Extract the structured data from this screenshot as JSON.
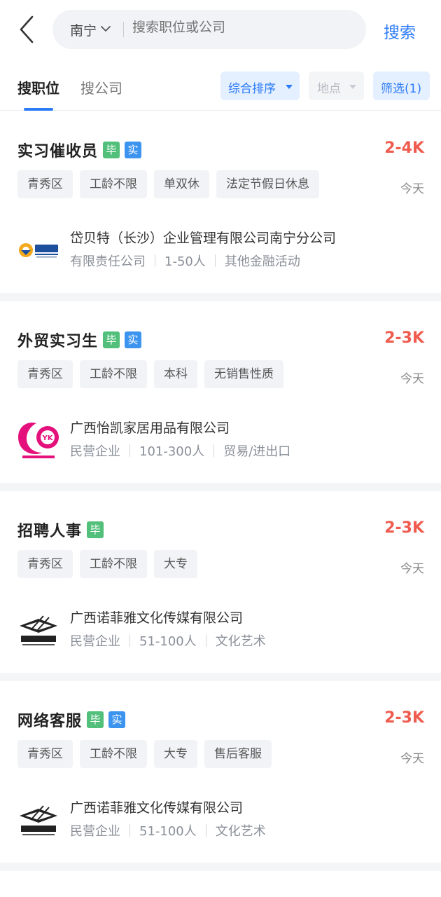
{
  "header": {
    "city": "南宁",
    "search_placeholder": "搜索职位或公司",
    "search_button": "搜索"
  },
  "tabs": {
    "jobs": "搜职位",
    "companies": "搜公司",
    "sort": "综合排序",
    "location": "地点",
    "filter": "筛选(1)"
  },
  "colors": {
    "accent": "#2d7cf6",
    "salary": "#ef5c4f",
    "grad_badge": "#52c07a",
    "intern_badge": "#3c94ef"
  },
  "jobs": [
    {
      "title": "实习催收员",
      "badges": [
        "毕",
        "实"
      ],
      "salary": "2-4K",
      "tags": [
        "青秀区",
        "工龄不限",
        "单双休",
        "法定节假日休息"
      ],
      "time": "今天",
      "company": "岱贝特（长沙）企业管理有限公司南宁分公司",
      "meta": [
        "有限责任公司",
        "1-50人",
        "其他金融活动"
      ],
      "logo": "daibeite-logo"
    },
    {
      "title": "外贸实习生",
      "badges": [
        "毕",
        "实"
      ],
      "salary": "2-3K",
      "tags": [
        "青秀区",
        "工龄不限",
        "本科",
        "无销售性质"
      ],
      "time": "今天",
      "company": "广西怡凯家居用品有限公司",
      "meta": [
        "民营企业",
        "101-300人",
        "贸易/进出口"
      ],
      "logo": "yikai-logo"
    },
    {
      "title": "招聘人事",
      "badges": [
        "毕"
      ],
      "salary": "2-3K",
      "tags": [
        "青秀区",
        "工龄不限",
        "大专"
      ],
      "time": "今天",
      "company": "广西诺菲雅文化传媒有限公司",
      "meta": [
        "民营企业",
        "51-100人",
        "文化艺术"
      ],
      "logo": "nuofeiya-logo"
    },
    {
      "title": "网络客服",
      "badges": [
        "毕",
        "实"
      ],
      "salary": "2-3K",
      "tags": [
        "青秀区",
        "工龄不限",
        "大专",
        "售后客服"
      ],
      "time": "今天",
      "company": "广西诺菲雅文化传媒有限公司",
      "meta": [
        "民营企业",
        "51-100人",
        "文化艺术"
      ],
      "logo": "nuofeiya-logo"
    }
  ]
}
